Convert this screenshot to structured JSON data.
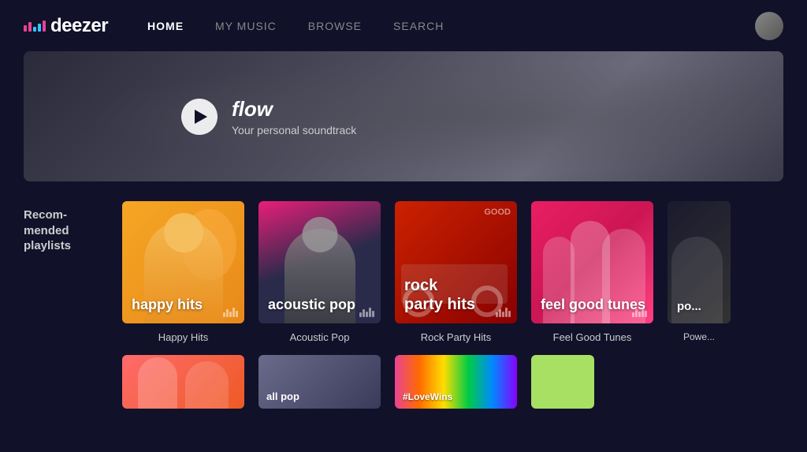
{
  "nav": {
    "logo_text": "deezer",
    "links": [
      {
        "id": "home",
        "label": "HOME",
        "active": true
      },
      {
        "id": "my-music",
        "label": "MY MUSIC",
        "active": false
      },
      {
        "id": "browse",
        "label": "BROWSE",
        "active": false
      },
      {
        "id": "search",
        "label": "SEARCH",
        "active": false
      }
    ]
  },
  "hero": {
    "play_label": "▶",
    "title": "flow",
    "subtitle": "Your personal soundtrack"
  },
  "recommended": {
    "section_label": "Recom-\nmended\nplaylists",
    "playlists": [
      {
        "id": "happy-hits",
        "cover_label": "happy hits",
        "name": "Happy Hits"
      },
      {
        "id": "acoustic-pop",
        "cover_label": "acoustic pop",
        "name": "Acoustic Pop"
      },
      {
        "id": "rock-party-hits",
        "cover_label": "rock\nparty hits",
        "name": "Rock Party Hits"
      },
      {
        "id": "feel-good-tunes",
        "cover_label": "feel good tunes",
        "name": "Feel Good Tunes"
      },
      {
        "id": "power",
        "cover_label": "po...",
        "name": "Powe..."
      }
    ]
  },
  "bottom_row": {
    "label": "...",
    "items": [
      {
        "id": "item1",
        "label": ""
      },
      {
        "id": "item2",
        "label": "all pop"
      },
      {
        "id": "item3",
        "label": "#LoveWins"
      },
      {
        "id": "item4",
        "label": ""
      }
    ]
  }
}
